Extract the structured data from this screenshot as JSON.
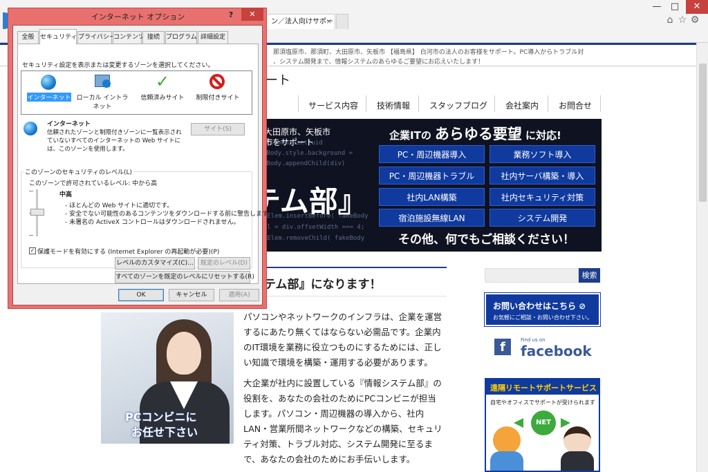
{
  "browser": {
    "tab_label": "ン／法人向けサポート",
    "close_tab": "×",
    "minimize": "—",
    "maximize": "□",
    "close": "✕",
    "home_icon": "home-icon",
    "star_icon": "star-icon",
    "gear_icon": "gear-icon"
  },
  "site": {
    "topbar_line1": "那須塩原市、那須町、大田原市、矢板市 【福島県】 白河市の法人のお客様をサポート。PC導入からトラブル対",
    "topbar_line2": "、システム開発まで、情報システムのあらゆるご要望にお応えいたします！",
    "logo_fragment": "ート",
    "nav": [
      "サービス内容",
      "技術情報",
      "スタッフブログ",
      "会社案内",
      "お問合せ"
    ],
    "hero": {
      "area_line1": "大田原市、矢板市",
      "area_line2": "市をサポート",
      "big_text": "テム部』",
      "headline_pre": "企業ITの",
      "headline_main": "あらゆる要望",
      "headline_post": "に対応!",
      "buttons": [
        "PC・周辺機器導入",
        "業務ソフト導入",
        "PC・周辺機器トラブル",
        "社内サーバ構築・導入",
        "社内LAN構築",
        "社内セキュリティ対策",
        "宿泊施設無線LAN",
        "システム開発"
      ],
      "footer": "その他、何でもご相談ください！",
      "code": [
        "tElement.set(uid",
        "tBody.style.background =",
        "tBody.appendChild(div)",
        "docElem.insertBefore( fakeBody",
        "pool = div.offsetWidth === 4;",
        "docElem.removeChild( fakeBody"
      ]
    },
    "section_title": "テム部』になります！",
    "photo_caption_1": "PCコンビニに",
    "photo_caption_2": "お任せ下さい",
    "para1": "パソコンやネットワークのインフラは、企業を運営するにあたり無くてはならない必需品です。企業内のIT環境を業務に役立つものにするためには、正しい知識で環境を構築・運用する必要があります。",
    "para2": "大企業が社内に設置している『情報システム部』の役割を、あなたの会社のためにPCコンビニが担当します。パソコン・周辺機器の導入から、社内LAN・営業所間ネットワークなどの構築、セキュリティ対策、トラブル対応、システム開発に至るまで、あなたの会社のためにお手伝いします。",
    "sidebar": {
      "search_button": "検索",
      "contact_title": "お問い合わせはこちら ⊘",
      "contact_sub": "お気軽にご相談・お問い合わせ下さい。",
      "fb_small": "Find us on",
      "fb_big": "facebook",
      "remote_title": "遠隔リモートサポートサービス",
      "remote_sub": "自宅やオフィスでサポートが受けられます",
      "net_label": "NET"
    }
  },
  "dialog": {
    "title": "インターネット オプション",
    "help": "?",
    "close": "✕",
    "tabs": [
      "全般",
      "セキュリティ",
      "プライバシー",
      "コンテンツ",
      "接続",
      "プログラム",
      "詳細設定"
    ],
    "instruction": "セキュリティ設定を表示または変更するゾーンを選択してください。",
    "zones": [
      {
        "label": "インターネット",
        "icon": "globe-icon"
      },
      {
        "label": "ローカル イントラネット",
        "icon": "intranet-icon"
      },
      {
        "label": "信頼済みサイト",
        "icon": "checkmark-icon"
      },
      {
        "label": "制限付きサイト",
        "icon": "restricted-icon"
      }
    ],
    "zone_title": "インターネット",
    "zone_desc": "信頼されたゾーンと制限付きゾーンに一覧表示されていないすべてのインターネットの Web サイトには、このゾーンを使用します。",
    "sites_button": "サイト(S)",
    "level_group": "このゾーンのセキュリティのレベル(L)",
    "allowed_levels": "このゾーンで許可されているレベル: 中から高",
    "level_name": "中高",
    "level_bullets": [
      "- ほとんどの Web サイトに適切です。",
      "- 安全でない可能性のあるコンテンツをダウンロードする前に警告します。",
      "- 未署名の ActiveX コントロールはダウンロードされません。"
    ],
    "protected_mode": "保護モードを有効にする (Internet Explorer の再起動が必要)(P)",
    "custom_level": "レベルのカスタマイズ(C)...",
    "default_level": "既定のレベル(D)",
    "reset_all": "すべてのゾーンを既定のレベルにリセットする(R)",
    "ok": "OK",
    "cancel": "キャンセル",
    "apply": "適用(A)"
  }
}
